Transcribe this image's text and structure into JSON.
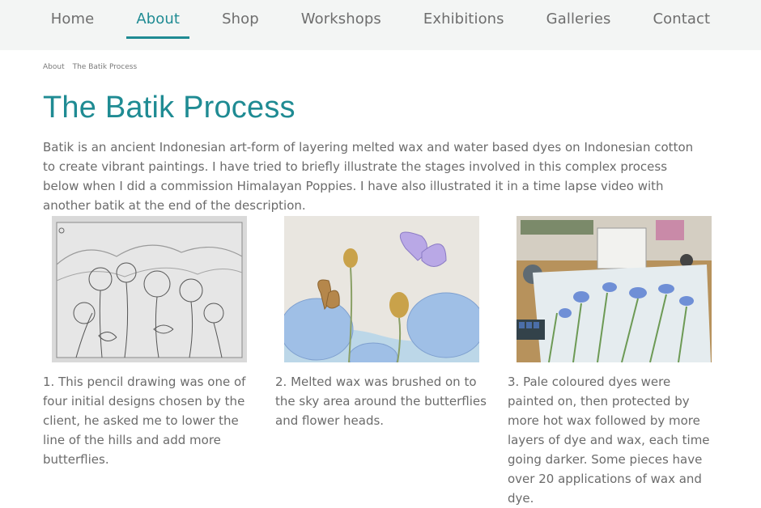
{
  "nav": {
    "items": [
      {
        "label": "Home",
        "active": false
      },
      {
        "label": "About",
        "active": true
      },
      {
        "label": "Shop",
        "active": false
      },
      {
        "label": "Workshops",
        "active": false
      },
      {
        "label": "Exhibitions",
        "active": false
      },
      {
        "label": "Galleries",
        "active": false
      },
      {
        "label": "Contact",
        "active": false
      }
    ]
  },
  "breadcrumb": {
    "parent": "About",
    "current": "The Batik Process"
  },
  "page": {
    "title": "The Batik Process",
    "intro": "Batik is an  ancient Indonesian art-form of layering melted wax and water based dyes on Indonesian cotton to create vibrant paintings. I have tried to briefly illustrate the stages involved in this complex process below when I did a commission Himalayan Poppies.  I have also illustrated it in a time lapse video with another batik at the end of the description."
  },
  "cards": [
    {
      "caption": "1. This pencil drawing was one of four initial designs chosen by the client, he asked me to lower the line of the hills and add more butterflies."
    },
    {
      "caption": "2. Melted wax was brushed on to the sky area around the butterflies and flower heads."
    },
    {
      "caption": "3. Pale coloured dyes were painted on, then protected by more hot wax followed by more layers of dye and wax, each time going darker. Some pieces have over 20 applications of wax and dye."
    }
  ],
  "theme": {
    "accent": "#1f8b93",
    "nav_bg": "#f3f5f4",
    "text": "#6b6b6b"
  }
}
